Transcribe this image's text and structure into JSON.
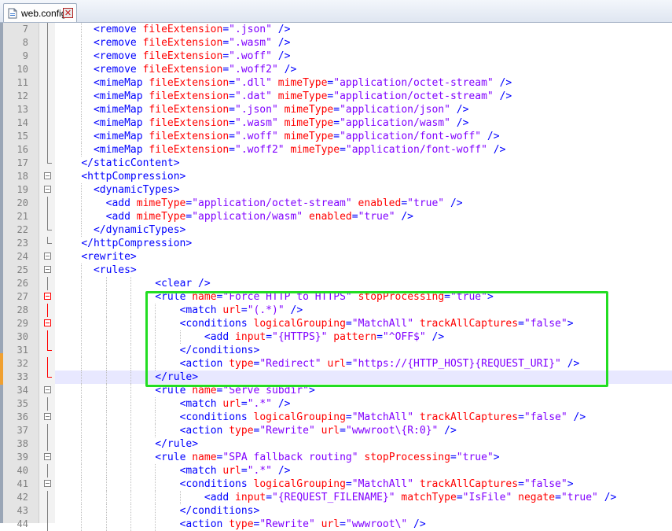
{
  "tab": {
    "title": "web.config",
    "close_glyph": "✕",
    "file_icon": "file-icon",
    "close_icon": "close-icon"
  },
  "colors": {
    "tag": "#0000ff",
    "attribute": "#ff0000",
    "value": "#8000ff",
    "highlight_box": "#22dd22",
    "current_line": "#e8e8ff"
  },
  "lines": [
    {
      "num": "7",
      "indent": 6,
      "tokens": [
        [
          "t",
          "<remove "
        ],
        [
          "a",
          "fileExtension"
        ],
        [
          "t",
          "="
        ],
        [
          "v",
          "\".json\""
        ],
        [
          "t",
          " />"
        ]
      ]
    },
    {
      "num": "8",
      "indent": 6,
      "tokens": [
        [
          "t",
          "<remove "
        ],
        [
          "a",
          "fileExtension"
        ],
        [
          "t",
          "="
        ],
        [
          "v",
          "\".wasm\""
        ],
        [
          "t",
          " />"
        ]
      ]
    },
    {
      "num": "9",
      "indent": 6,
      "tokens": [
        [
          "t",
          "<remove "
        ],
        [
          "a",
          "fileExtension"
        ],
        [
          "t",
          "="
        ],
        [
          "v",
          "\".woff\""
        ],
        [
          "t",
          " />"
        ]
      ]
    },
    {
      "num": "10",
      "indent": 6,
      "tokens": [
        [
          "t",
          "<remove "
        ],
        [
          "a",
          "fileExtension"
        ],
        [
          "t",
          "="
        ],
        [
          "v",
          "\".woff2\""
        ],
        [
          "t",
          " />"
        ]
      ]
    },
    {
      "num": "11",
      "indent": 6,
      "tokens": [
        [
          "t",
          "<mimeMap "
        ],
        [
          "a",
          "fileExtension"
        ],
        [
          "t",
          "="
        ],
        [
          "v",
          "\".dll\""
        ],
        [
          "t",
          " "
        ],
        [
          "a",
          "mimeType"
        ],
        [
          "t",
          "="
        ],
        [
          "v",
          "\"application/octet-stream\""
        ],
        [
          "t",
          " />"
        ]
      ]
    },
    {
      "num": "12",
      "indent": 6,
      "tokens": [
        [
          "t",
          "<mimeMap "
        ],
        [
          "a",
          "fileExtension"
        ],
        [
          "t",
          "="
        ],
        [
          "v",
          "\".dat\""
        ],
        [
          "t",
          " "
        ],
        [
          "a",
          "mimeType"
        ],
        [
          "t",
          "="
        ],
        [
          "v",
          "\"application/octet-stream\""
        ],
        [
          "t",
          " />"
        ]
      ]
    },
    {
      "num": "13",
      "indent": 6,
      "tokens": [
        [
          "t",
          "<mimeMap "
        ],
        [
          "a",
          "fileExtension"
        ],
        [
          "t",
          "="
        ],
        [
          "v",
          "\".json\""
        ],
        [
          "t",
          " "
        ],
        [
          "a",
          "mimeType"
        ],
        [
          "t",
          "="
        ],
        [
          "v",
          "\"application/json\""
        ],
        [
          "t",
          " />"
        ]
      ]
    },
    {
      "num": "14",
      "indent": 6,
      "tokens": [
        [
          "t",
          "<mimeMap "
        ],
        [
          "a",
          "fileExtension"
        ],
        [
          "t",
          "="
        ],
        [
          "v",
          "\".wasm\""
        ],
        [
          "t",
          " "
        ],
        [
          "a",
          "mimeType"
        ],
        [
          "t",
          "="
        ],
        [
          "v",
          "\"application/wasm\""
        ],
        [
          "t",
          " />"
        ]
      ]
    },
    {
      "num": "15",
      "indent": 6,
      "tokens": [
        [
          "t",
          "<mimeMap "
        ],
        [
          "a",
          "fileExtension"
        ],
        [
          "t",
          "="
        ],
        [
          "v",
          "\".woff\""
        ],
        [
          "t",
          " "
        ],
        [
          "a",
          "mimeType"
        ],
        [
          "t",
          "="
        ],
        [
          "v",
          "\"application/font-woff\""
        ],
        [
          "t",
          " />"
        ]
      ]
    },
    {
      "num": "16",
      "indent": 6,
      "tokens": [
        [
          "t",
          "<mimeMap "
        ],
        [
          "a",
          "fileExtension"
        ],
        [
          "t",
          "="
        ],
        [
          "v",
          "\".woff2\""
        ],
        [
          "t",
          " "
        ],
        [
          "a",
          "mimeType"
        ],
        [
          "t",
          "="
        ],
        [
          "v",
          "\"application/font-woff\""
        ],
        [
          "t",
          " />"
        ]
      ]
    },
    {
      "num": "17",
      "indent": 4,
      "tokens": [
        [
          "t",
          "</staticContent>"
        ]
      ]
    },
    {
      "num": "18",
      "indent": 4,
      "tokens": [
        [
          "t",
          "<httpCompression>"
        ]
      ]
    },
    {
      "num": "19",
      "indent": 6,
      "tokens": [
        [
          "t",
          "<dynamicTypes>"
        ]
      ]
    },
    {
      "num": "20",
      "indent": 8,
      "tokens": [
        [
          "t",
          "<add "
        ],
        [
          "a",
          "mimeType"
        ],
        [
          "t",
          "="
        ],
        [
          "v",
          "\"application/octet-stream\""
        ],
        [
          "t",
          " "
        ],
        [
          "a",
          "enabled"
        ],
        [
          "t",
          "="
        ],
        [
          "v",
          "\"true\""
        ],
        [
          "t",
          " />"
        ]
      ]
    },
    {
      "num": "21",
      "indent": 8,
      "tokens": [
        [
          "t",
          "<add "
        ],
        [
          "a",
          "mimeType"
        ],
        [
          "t",
          "="
        ],
        [
          "v",
          "\"application/wasm\""
        ],
        [
          "t",
          " "
        ],
        [
          "a",
          "enabled"
        ],
        [
          "t",
          "="
        ],
        [
          "v",
          "\"true\""
        ],
        [
          "t",
          " />"
        ]
      ]
    },
    {
      "num": "22",
      "indent": 6,
      "tokens": [
        [
          "t",
          "</dynamicTypes>"
        ]
      ]
    },
    {
      "num": "23",
      "indent": 4,
      "tokens": [
        [
          "t",
          "</httpCompression>"
        ]
      ]
    },
    {
      "num": "24",
      "indent": 4,
      "tokens": [
        [
          "t",
          "<rewrite>"
        ]
      ]
    },
    {
      "num": "25",
      "indent": 6,
      "tokens": [
        [
          "t",
          "<rules>"
        ]
      ]
    },
    {
      "num": "26",
      "indent": 16,
      "tokens": [
        [
          "t",
          "<clear />"
        ]
      ]
    },
    {
      "num": "27",
      "indent": 16,
      "tokens": [
        [
          "t",
          "<rule "
        ],
        [
          "a",
          "name"
        ],
        [
          "t",
          "="
        ],
        [
          "v",
          "\"Force HTTP to HTTPS\""
        ],
        [
          "t",
          " "
        ],
        [
          "a",
          "stopProcessing"
        ],
        [
          "t",
          "="
        ],
        [
          "v",
          "\"true\""
        ],
        [
          "t",
          ">"
        ]
      ]
    },
    {
      "num": "28",
      "indent": 20,
      "tokens": [
        [
          "t",
          "<match "
        ],
        [
          "a",
          "url"
        ],
        [
          "t",
          "="
        ],
        [
          "v",
          "\"(.*)\""
        ],
        [
          "t",
          " />"
        ]
      ]
    },
    {
      "num": "29",
      "indent": 20,
      "tokens": [
        [
          "t",
          "<conditions "
        ],
        [
          "a",
          "logicalGrouping"
        ],
        [
          "t",
          "="
        ],
        [
          "v",
          "\"MatchAll\""
        ],
        [
          "t",
          " "
        ],
        [
          "a",
          "trackAllCaptures"
        ],
        [
          "t",
          "="
        ],
        [
          "v",
          "\"false\""
        ],
        [
          "t",
          ">"
        ]
      ]
    },
    {
      "num": "30",
      "indent": 24,
      "tokens": [
        [
          "t",
          "<add "
        ],
        [
          "a",
          "input"
        ],
        [
          "t",
          "="
        ],
        [
          "v",
          "\"{HTTPS}\""
        ],
        [
          "t",
          " "
        ],
        [
          "a",
          "pattern"
        ],
        [
          "t",
          "="
        ],
        [
          "v",
          "\"^OFF$\""
        ],
        [
          "t",
          " />"
        ]
      ]
    },
    {
      "num": "31",
      "indent": 20,
      "tokens": [
        [
          "t",
          "</conditions>"
        ]
      ]
    },
    {
      "num": "32",
      "indent": 20,
      "tokens": [
        [
          "t",
          "<action "
        ],
        [
          "a",
          "type"
        ],
        [
          "t",
          "="
        ],
        [
          "v",
          "\"Redirect\""
        ],
        [
          "t",
          " "
        ],
        [
          "a",
          "url"
        ],
        [
          "t",
          "="
        ],
        [
          "v",
          "\"https://{HTTP_HOST}{REQUEST_URI}\""
        ],
        [
          "t",
          " />"
        ]
      ]
    },
    {
      "num": "33",
      "indent": 16,
      "tokens": [
        [
          "t",
          "</rule>"
        ]
      ]
    },
    {
      "num": "34",
      "indent": 16,
      "tokens": [
        [
          "t",
          "<rule "
        ],
        [
          "a",
          "name"
        ],
        [
          "t",
          "="
        ],
        [
          "v",
          "\"Serve subdir\""
        ],
        [
          "t",
          ">"
        ]
      ]
    },
    {
      "num": "35",
      "indent": 20,
      "tokens": [
        [
          "t",
          "<match "
        ],
        [
          "a",
          "url"
        ],
        [
          "t",
          "="
        ],
        [
          "v",
          "\".*\""
        ],
        [
          "t",
          " />"
        ]
      ]
    },
    {
      "num": "36",
      "indent": 20,
      "tokens": [
        [
          "t",
          "<conditions "
        ],
        [
          "a",
          "logicalGrouping"
        ],
        [
          "t",
          "="
        ],
        [
          "v",
          "\"MatchAll\""
        ],
        [
          "t",
          " "
        ],
        [
          "a",
          "trackAllCaptures"
        ],
        [
          "t",
          "="
        ],
        [
          "v",
          "\"false\""
        ],
        [
          "t",
          " />"
        ]
      ]
    },
    {
      "num": "37",
      "indent": 20,
      "tokens": [
        [
          "t",
          "<action "
        ],
        [
          "a",
          "type"
        ],
        [
          "t",
          "="
        ],
        [
          "v",
          "\"Rewrite\""
        ],
        [
          "t",
          " "
        ],
        [
          "a",
          "url"
        ],
        [
          "t",
          "="
        ],
        [
          "v",
          "\"wwwroot\\{R:0}\""
        ],
        [
          "t",
          " />"
        ]
      ]
    },
    {
      "num": "38",
      "indent": 16,
      "tokens": [
        [
          "t",
          "</rule>"
        ]
      ]
    },
    {
      "num": "39",
      "indent": 16,
      "tokens": [
        [
          "t",
          "<rule "
        ],
        [
          "a",
          "name"
        ],
        [
          "t",
          "="
        ],
        [
          "v",
          "\"SPA fallback routing\""
        ],
        [
          "t",
          " "
        ],
        [
          "a",
          "stopProcessing"
        ],
        [
          "t",
          "="
        ],
        [
          "v",
          "\"true\""
        ],
        [
          "t",
          ">"
        ]
      ]
    },
    {
      "num": "40",
      "indent": 20,
      "tokens": [
        [
          "t",
          "<match "
        ],
        [
          "a",
          "url"
        ],
        [
          "t",
          "="
        ],
        [
          "v",
          "\".*\""
        ],
        [
          "t",
          " />"
        ]
      ]
    },
    {
      "num": "41",
      "indent": 20,
      "tokens": [
        [
          "t",
          "<conditions "
        ],
        [
          "a",
          "logicalGrouping"
        ],
        [
          "t",
          "="
        ],
        [
          "v",
          "\"MatchAll\""
        ],
        [
          "t",
          " "
        ],
        [
          "a",
          "trackAllCaptures"
        ],
        [
          "t",
          "="
        ],
        [
          "v",
          "\"false\""
        ],
        [
          "t",
          ">"
        ]
      ]
    },
    {
      "num": "42",
      "indent": 24,
      "tokens": [
        [
          "t",
          "<add "
        ],
        [
          "a",
          "input"
        ],
        [
          "t",
          "="
        ],
        [
          "v",
          "\"{REQUEST_FILENAME}\""
        ],
        [
          "t",
          " "
        ],
        [
          "a",
          "matchType"
        ],
        [
          "t",
          "="
        ],
        [
          "v",
          "\"IsFile\""
        ],
        [
          "t",
          " "
        ],
        [
          "a",
          "negate"
        ],
        [
          "t",
          "="
        ],
        [
          "v",
          "\"true\""
        ],
        [
          "t",
          " />"
        ]
      ]
    },
    {
      "num": "43",
      "indent": 20,
      "tokens": [
        [
          "t",
          "</conditions>"
        ]
      ]
    },
    {
      "num": "44",
      "indent": 20,
      "tokens": [
        [
          "t",
          "<action "
        ],
        [
          "a",
          "type"
        ],
        [
          "t",
          "="
        ],
        [
          "v",
          "\"Rewrite\""
        ],
        [
          "t",
          " "
        ],
        [
          "a",
          "url"
        ],
        [
          "t",
          "="
        ],
        [
          "v",
          "\"wwwroot\\\""
        ],
        [
          "t",
          " />"
        ]
      ]
    }
  ]
}
